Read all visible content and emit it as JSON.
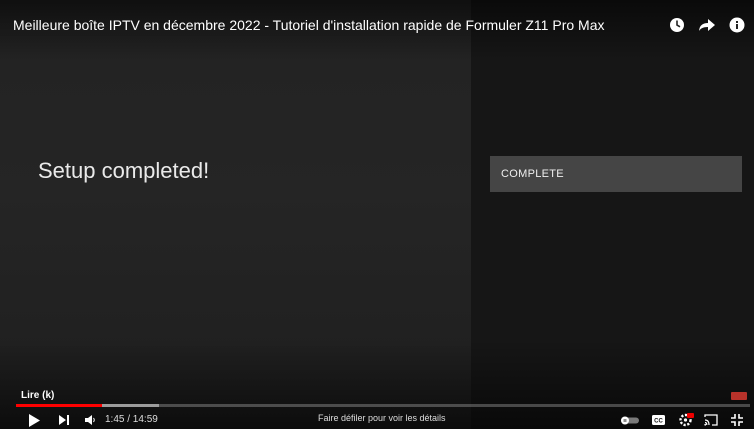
{
  "player": {
    "title": "Meilleure boîte IPTV en décembre 2022 - Tutoriel d'installation rapide de Formuler Z11 Pro Max",
    "top_icons": [
      "clock-icon",
      "share-icon",
      "info-icon"
    ]
  },
  "screen": {
    "setup_message": "Setup completed!",
    "complete_button": "COMPLETE"
  },
  "controls": {
    "tooltip": "Lire (k)",
    "time_display": "1:45 / 14:59",
    "scroll_hint": "Faire défiler pour voir les détails",
    "progress_played_fraction": 0.117,
    "progress_buffered_fraction": 0.195,
    "accent_color": "#ff0000",
    "icons": [
      "play-icon",
      "next-icon",
      "volume-icon",
      "autoplay-toggle-icon",
      "subtitles-icon",
      "settings-icon",
      "cast-icon",
      "exit-fullscreen-icon"
    ]
  }
}
